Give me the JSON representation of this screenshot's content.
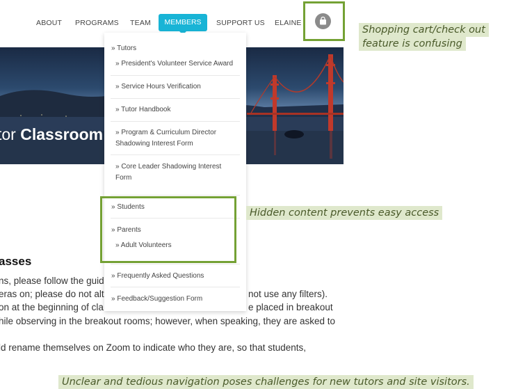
{
  "nav": {
    "items": [
      "ABOUT",
      "PROGRAMS",
      "TEAM",
      "MEMBERS",
      "SUPPORT US",
      "ELAINE"
    ],
    "active": "MEMBERS",
    "cart_icon": "shopping-bag-icon"
  },
  "hero": {
    "title_light": "tor ",
    "title_bold": "Classroom"
  },
  "dropdown": {
    "items": [
      "» Tutors",
      "» President's Volunteer Service Award",
      "» Service Hours Verification",
      "» Tutor Handbook",
      "» Program & Curriculum Director Shadowing Interest Form",
      "» Core Leader Shadowing Interest Form",
      "» Students",
      "» Parents",
      "» Adult Volunteers",
      "» Frequently Asked Questions",
      "» Feedback/Suggestion Form"
    ]
  },
  "content": {
    "heading": "asses",
    "left_lines": [
      "ns, please follow the guid",
      "eras on; please do not alt",
      "on at the beginning of cla",
      "hile observing in the breakout rooms; however, when speaking, they are asked to"
    ],
    "right_lines": [
      "not use any filters).",
      "e placed in breakout"
    ],
    "last_line": "ld rename themselves on Zoom to indicate who they are, so that students,"
  },
  "annotations": {
    "cart": [
      "Shopping cart/check out",
      "feature is confusing"
    ],
    "hidden": "Hidden content prevents easy access",
    "nav": "Unclear and tedious navigation poses challenges for new tutors and site visitors."
  },
  "colors": {
    "accent": "#18b4d6",
    "highlight_border": "#74a134",
    "annotation_bg": "#dfe8cc"
  }
}
